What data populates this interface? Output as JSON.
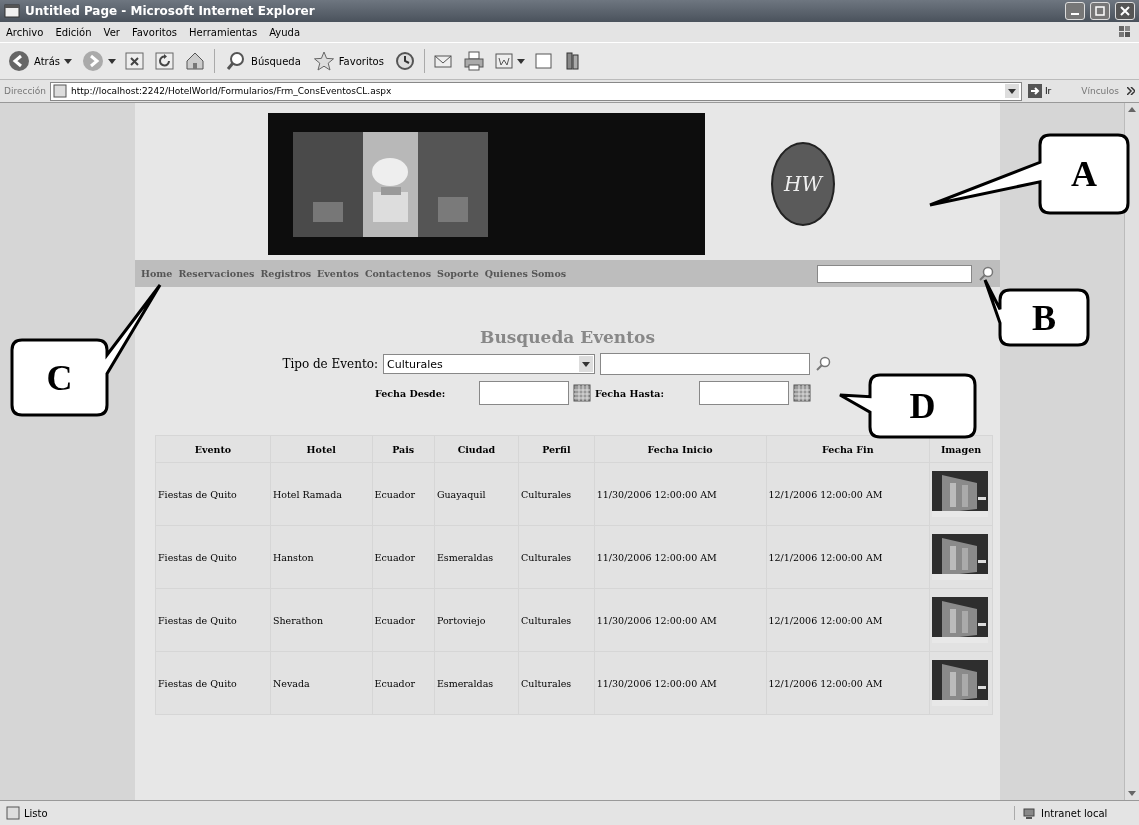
{
  "window": {
    "title": "Untitled Page - Microsoft Internet Explorer"
  },
  "menu": [
    "Archivo",
    "Edición",
    "Ver",
    "Favoritos",
    "Herramientas",
    "Ayuda"
  ],
  "toolbar": {
    "back": "Atrás",
    "search": "Búsqueda",
    "favorites": "Favoritos"
  },
  "address": {
    "label": "Dirección",
    "url": "http://localhost:2242/HotelWorld/Formularios/Frm_ConsEventosCL.aspx",
    "go": "Ir",
    "links": "Vínculos"
  },
  "banner": {
    "logo": "HW"
  },
  "nav": {
    "items": [
      "Home",
      "Reservaciones",
      "Registros",
      "Eventos",
      "Contactenos",
      "Soporte",
      "Quienes Somos"
    ]
  },
  "form": {
    "title": "Busqueda Eventos",
    "type_label": "Tipo de Evento:",
    "type_value": "Culturales",
    "from_label": "Fecha Desde:",
    "to_label": "Fecha Hasta:"
  },
  "table": {
    "columns": [
      "Evento",
      "Hotel",
      "Pais",
      "Ciudad",
      "Perfil",
      "Fecha Inicio",
      "Fecha Fin",
      "Imagen"
    ],
    "rows": [
      [
        "Fiestas de Quito",
        "Hotel Ramada",
        "Ecuador",
        "Guayaquil",
        "Culturales",
        "11/30/2006 12:00:00 AM",
        "12/1/2006 12:00:00 AM"
      ],
      [
        "Fiestas de Quito",
        "Hanston",
        "Ecuador",
        "Esmeraldas",
        "Culturales",
        "11/30/2006 12:00:00 AM",
        "12/1/2006 12:00:00 AM"
      ],
      [
        "Fiestas de Quito",
        "Sherathon",
        "Ecuador",
        "Portoviejo",
        "Culturales",
        "11/30/2006 12:00:00 AM",
        "12/1/2006 12:00:00 AM"
      ],
      [
        "Fiestas de Quito",
        "Nevada",
        "Ecuador",
        "Esmeraldas",
        "Culturales",
        "11/30/2006 12:00:00 AM",
        "12/1/2006 12:00:00 AM"
      ]
    ]
  },
  "callouts": [
    "A",
    "B",
    "C",
    "D"
  ],
  "status_bar": {
    "text": "Listo",
    "zone": "Intranet local"
  }
}
